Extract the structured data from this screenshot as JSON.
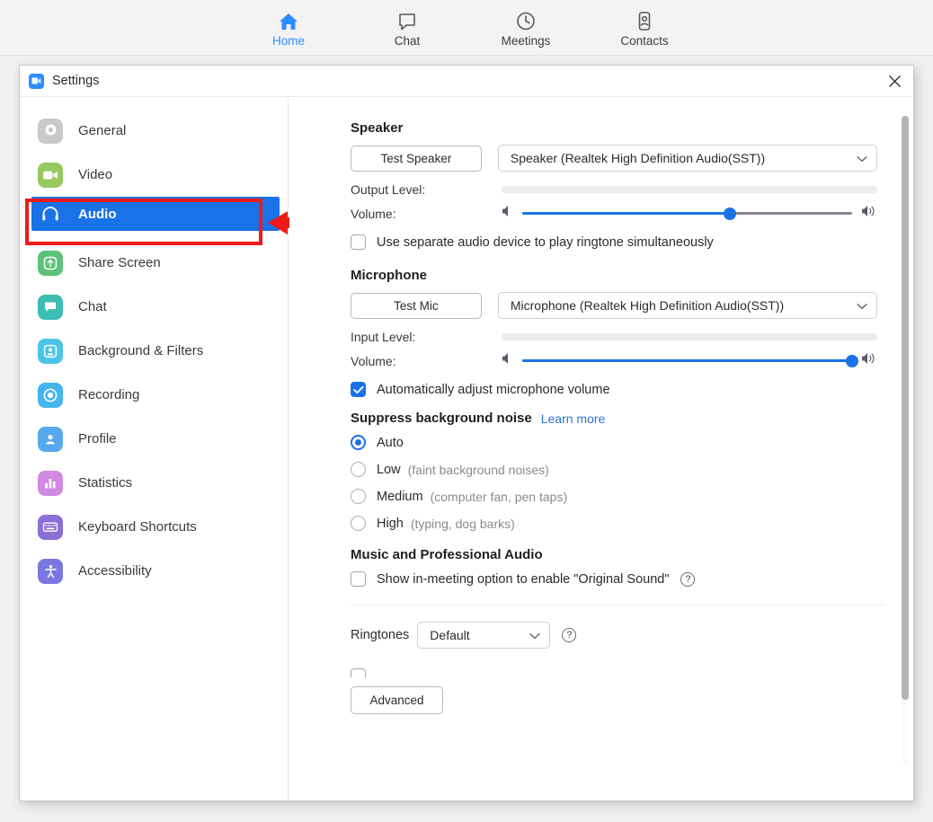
{
  "topnav": {
    "items": [
      {
        "label": "Home",
        "icon": "home-icon",
        "active": true
      },
      {
        "label": "Chat",
        "icon": "chat-bubble-icon",
        "active": false
      },
      {
        "label": "Meetings",
        "icon": "clock-icon",
        "active": false
      },
      {
        "label": "Contacts",
        "icon": "contact-person-icon",
        "active": false
      }
    ]
  },
  "window": {
    "title": "Settings",
    "logo_icon": "zoom-camera-icon",
    "close_icon": "close-icon"
  },
  "sidebar": {
    "items": [
      {
        "label": "General",
        "icon": "gear-icon",
        "color": "#c9c9c9"
      },
      {
        "label": "Video",
        "icon": "video-camera-icon",
        "color": "#96c95f"
      },
      {
        "label": "Audio",
        "icon": "headphones-icon",
        "color": "#1a72e8",
        "selected": true
      },
      {
        "label": "Share Screen",
        "icon": "upload-arrow-icon",
        "color": "#5cc27a"
      },
      {
        "label": "Chat",
        "icon": "chat-bubble-icon",
        "color": "#3bbdb4"
      },
      {
        "label": "Background & Filters",
        "icon": "person-frame-icon",
        "color": "#4cc3e8"
      },
      {
        "label": "Recording",
        "icon": "record-circle-icon",
        "color": "#46b5ec"
      },
      {
        "label": "Profile",
        "icon": "person-icon",
        "color": "#56a9ec"
      },
      {
        "label": "Statistics",
        "icon": "bar-chart-icon",
        "color": "#d08ae0"
      },
      {
        "label": "Keyboard Shortcuts",
        "icon": "keyboard-icon",
        "color": "#8a6fd6"
      },
      {
        "label": "Accessibility",
        "icon": "accessibility-icon",
        "color": "#7a78e0"
      }
    ]
  },
  "annotation": {
    "highlight_color": "#ee1b1b",
    "arrow_icon": "left-arrow-annotation"
  },
  "content": {
    "speaker": {
      "heading": "Speaker",
      "test_button": "Test Speaker",
      "device": "Speaker (Realtek High Definition Audio(SST))",
      "output_level_label": "Output Level:",
      "output_level_value": 0,
      "volume_label": "Volume:",
      "volume_value": 63,
      "low_icon": "volume-low-icon",
      "high_icon": "volume-high-icon",
      "ringtone_checkbox": {
        "label": "Use separate audio device to play ringtone simultaneously",
        "checked": false
      }
    },
    "microphone": {
      "heading": "Microphone",
      "test_button": "Test Mic",
      "device": "Microphone (Realtek High Definition Audio(SST))",
      "input_level_label": "Input Level:",
      "input_level_value": 0,
      "volume_label": "Volume:",
      "volume_value": 100,
      "low_icon": "volume-low-icon",
      "high_icon": "volume-high-icon",
      "auto_adjust_checkbox": {
        "label": "Automatically adjust microphone volume",
        "checked": true
      }
    },
    "suppress_noise": {
      "heading": "Suppress background noise",
      "learn_more": "Learn more",
      "selected": "Auto",
      "options": [
        {
          "label": "Auto",
          "hint": "",
          "selected": true
        },
        {
          "label": "Low",
          "hint": "(faint background noises)",
          "selected": false
        },
        {
          "label": "Medium",
          "hint": "(computer fan, pen taps)",
          "selected": false
        },
        {
          "label": "High",
          "hint": "(typing, dog barks)",
          "selected": false
        }
      ]
    },
    "music_audio": {
      "heading": "Music and Professional Audio",
      "original_sound_checkbox": {
        "label": "Show in-meeting option to enable \"Original Sound\"",
        "checked": false
      },
      "help_icon": "help-circle-icon"
    },
    "ringtones": {
      "label": "Ringtones",
      "value": "Default",
      "help_icon": "help-circle-icon"
    },
    "advanced_button": "Advanced"
  },
  "scrollbar": {
    "icon": "vertical-scrollbar-thumb"
  }
}
